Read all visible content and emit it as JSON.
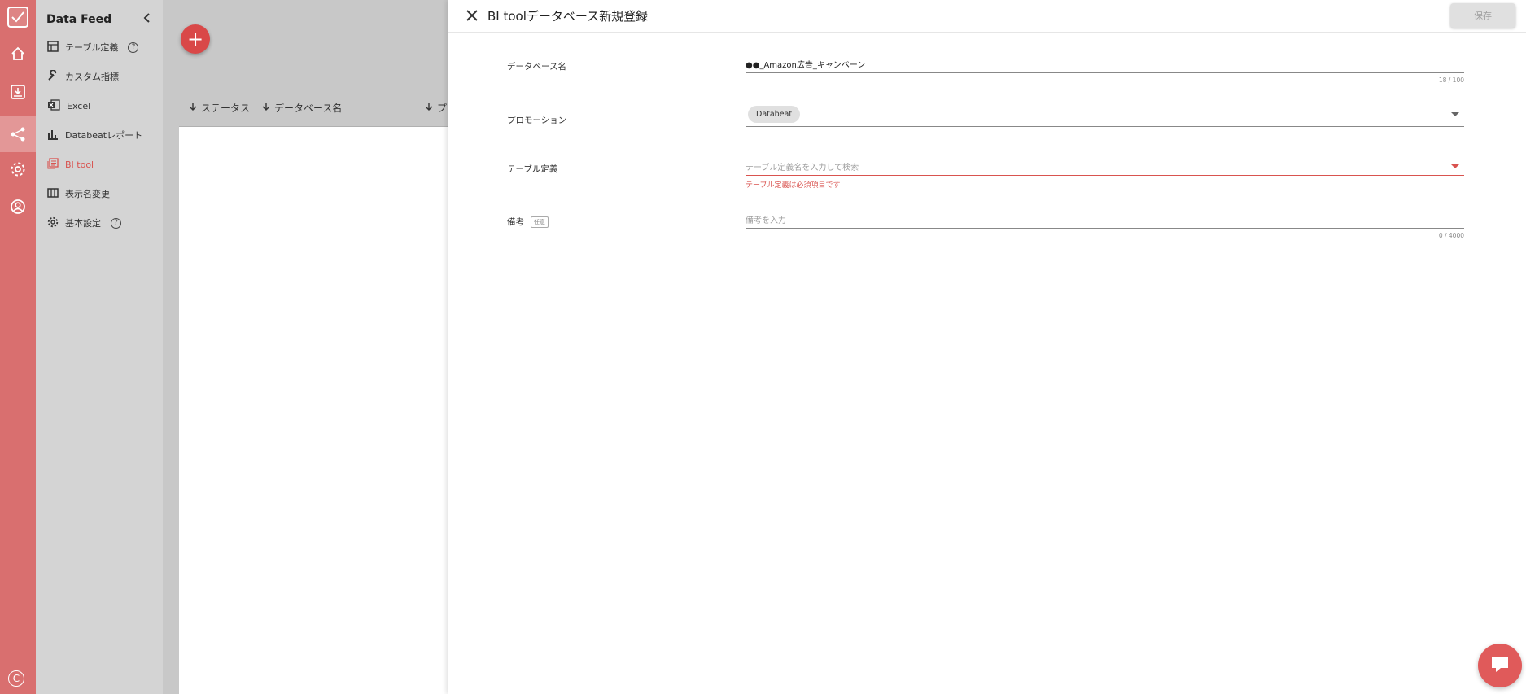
{
  "colors": {
    "accent": "#d96f6f",
    "error": "#d9534f",
    "fab": "#d94848"
  },
  "app": {
    "user_initial": "C"
  },
  "sidebar": {
    "title": "Data Feed",
    "items": [
      {
        "label": "テーブル定義",
        "icon": "table-icon",
        "help": "?"
      },
      {
        "label": "カスタム指標",
        "icon": "wrench-icon"
      },
      {
        "label": "Excel",
        "icon": "excel-icon"
      },
      {
        "label": "Databeatレポート",
        "icon": "bar-chart-icon"
      },
      {
        "label": "BI tool",
        "icon": "report-icon",
        "active": true
      },
      {
        "label": "表示名変更",
        "icon": "columns-icon"
      },
      {
        "label": "基本設定",
        "icon": "gear-icon",
        "help": "?"
      }
    ]
  },
  "list": {
    "fab": "+",
    "columns": [
      {
        "label": "ステータス"
      },
      {
        "label": "データベース名"
      },
      {
        "label": "プ"
      }
    ]
  },
  "drawer": {
    "title": "BI toolデータベース新規登録",
    "save_label": "保存",
    "fields": {
      "db_name": {
        "label": "データベース名",
        "value": "●●_Amazon広告_キャンペーン",
        "counter": "18 / 100"
      },
      "promotion": {
        "label": "プロモーション",
        "chip": "Databeat"
      },
      "table_def": {
        "label": "テーブル定義",
        "placeholder": "テーブル定義名を入力して検索",
        "error": "テーブル定義は必須項目です"
      },
      "remarks": {
        "label": "備考",
        "optional": "任意",
        "placeholder": "備考を入力",
        "counter": "0 / 4000"
      }
    }
  }
}
